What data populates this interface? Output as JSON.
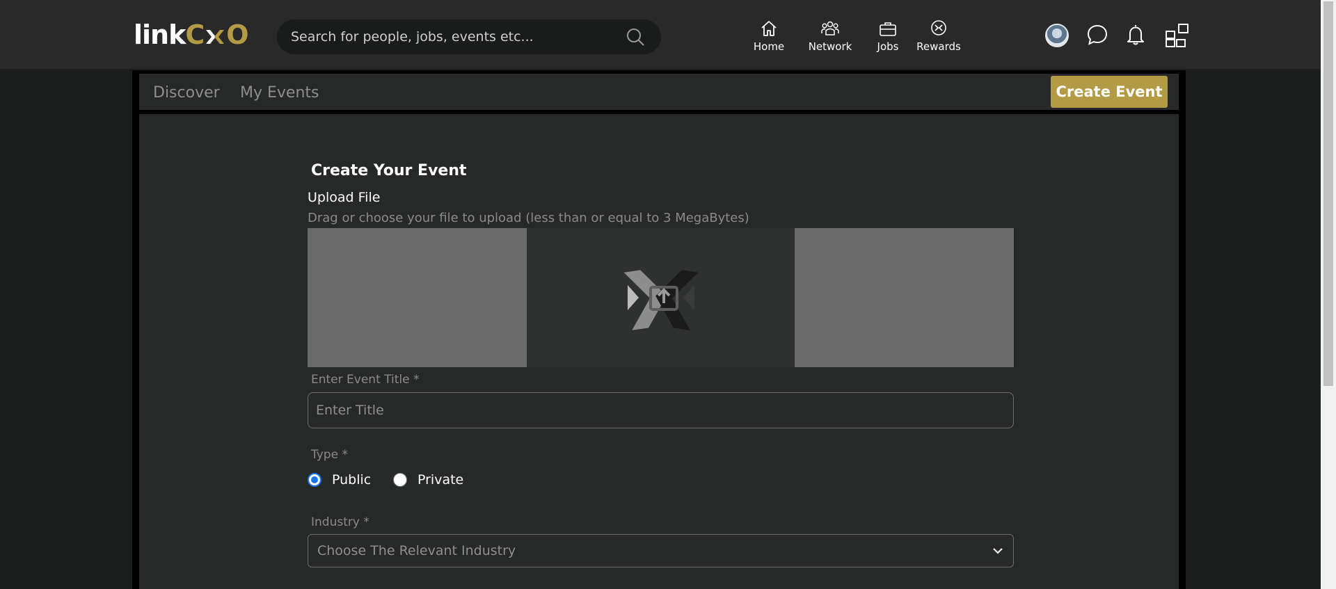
{
  "header": {
    "logo_link": "link",
    "logo_c": "C",
    "logo_o": "O",
    "search_placeholder": "Search for people, jobs, events etc...",
    "nav": [
      {
        "label": "Home",
        "icon": "home-icon"
      },
      {
        "label": "Network",
        "icon": "network-icon"
      },
      {
        "label": "Jobs",
        "icon": "briefcase-icon"
      },
      {
        "label": "Rewards",
        "icon": "rewards-icon"
      }
    ],
    "right_icons": [
      "avatar",
      "chat-icon",
      "bell-icon",
      "apps-grid-icon"
    ]
  },
  "subnav": {
    "tabs": [
      {
        "label": "Discover"
      },
      {
        "label": "My Events"
      }
    ],
    "create_button": "Create Event"
  },
  "form": {
    "title": "Create Your Event",
    "upload_label": "Upload File",
    "upload_hint": "Drag or choose your file to upload (less than or equal to 3 MegaBytes)",
    "event_title_label": "Enter Event Title *",
    "event_title_placeholder": "Enter Title",
    "type_label": "Type *",
    "type_options": [
      {
        "label": "Public",
        "checked": true
      },
      {
        "label": "Private",
        "checked": false
      }
    ],
    "industry_label": "Industry *",
    "industry_placeholder": "Choose The Relevant Industry"
  },
  "colors": {
    "brand_gold": "#b39a45",
    "topbar": "#282928",
    "panel": "#272828",
    "radio_accent": "#1a73e8"
  }
}
